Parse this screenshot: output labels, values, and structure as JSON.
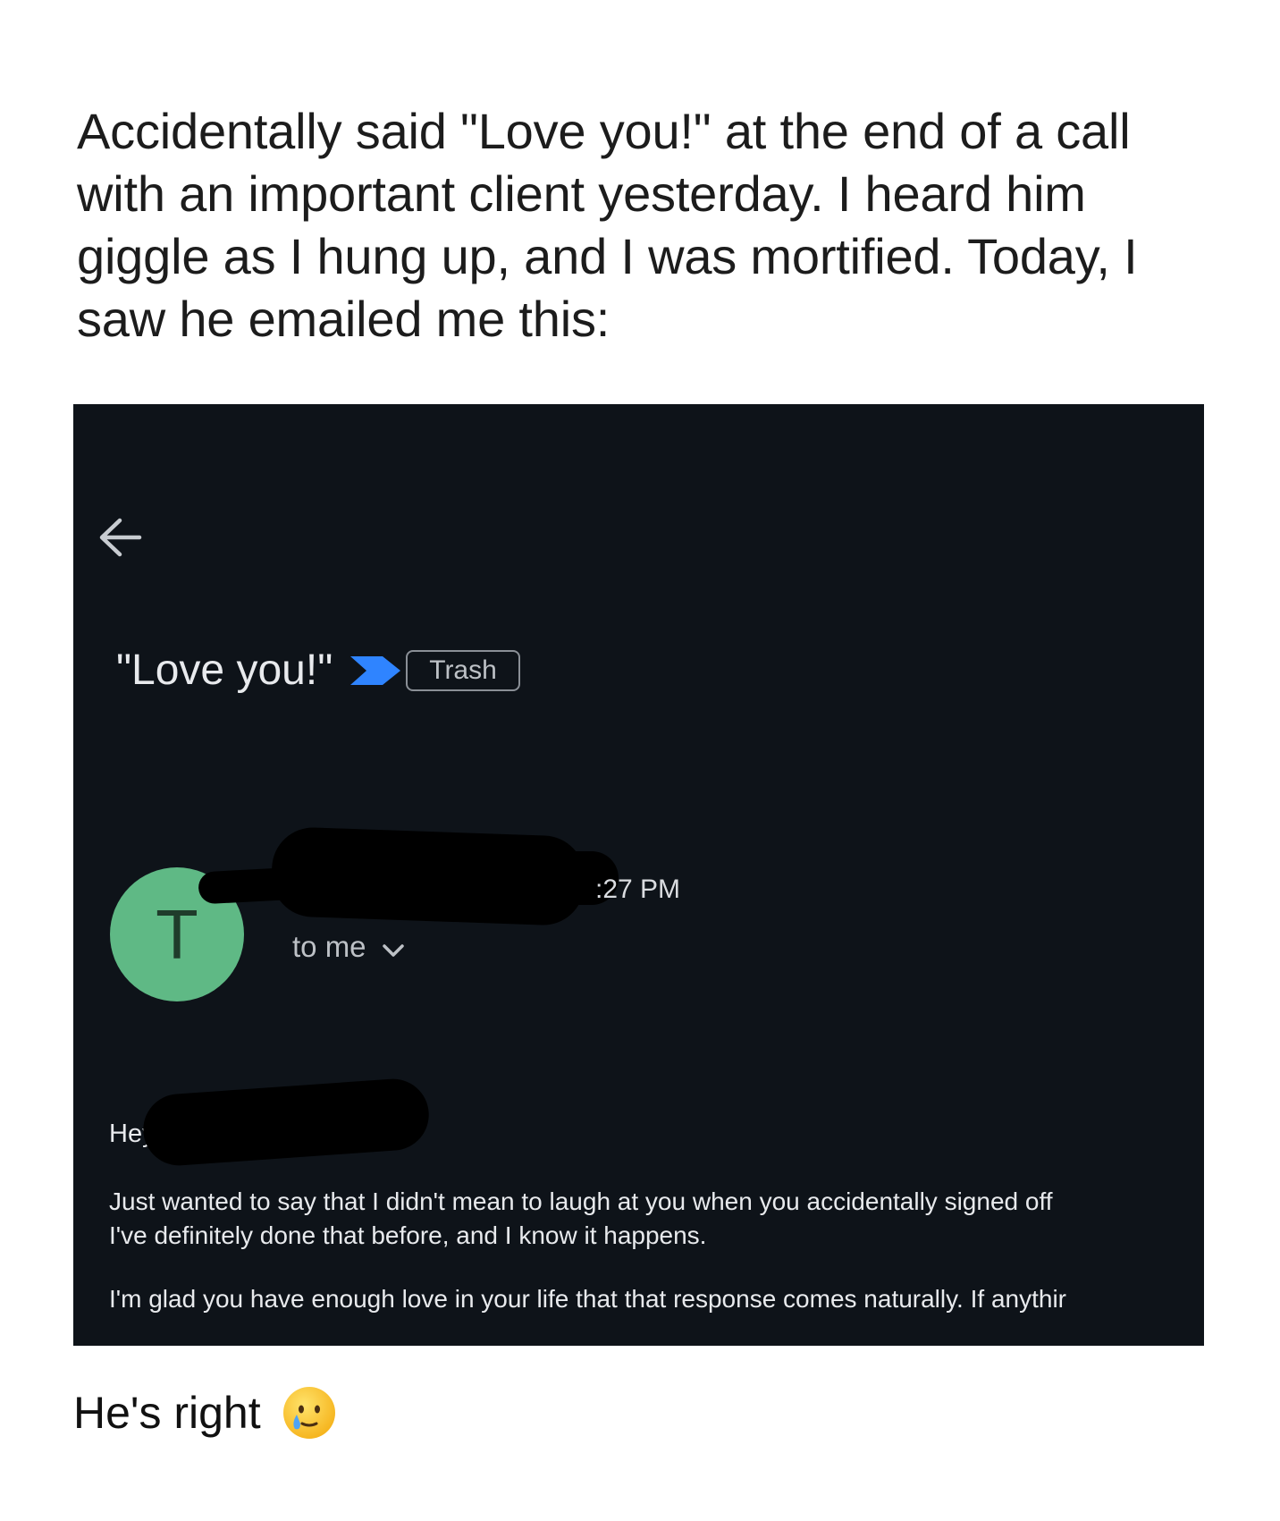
{
  "post": {
    "caption": "Accidentally said \"Love you!\" at the end of a call with an important client yesterday. I heard him giggle as I hung up, and I was mortified. Today, I saw he emailed me this:",
    "footer": "He's right"
  },
  "email": {
    "subject": "\"Love you!\"",
    "label": "Trash",
    "sender_initial": "T",
    "time": ":27 PM",
    "recipient": "to me",
    "greeting": "Hey .",
    "paragraphs": [
      "Just wanted to say that I didn't mean to laugh at you when you accidentally signed off",
      "I've definitely done that before, and I know it happens.",
      "I'm glad you have enough love in your life that that response comes naturally. If anythir"
    ]
  },
  "colors": {
    "email_background": "#0e1319",
    "avatar": "#5fb985",
    "importance_marker": "#2f84ff"
  },
  "icons": {
    "back": "arrow-left-icon",
    "importance": "importance-marker-icon",
    "expand": "chevron-down-icon",
    "footer_emoji": "crying-smiling-face-emoji"
  }
}
